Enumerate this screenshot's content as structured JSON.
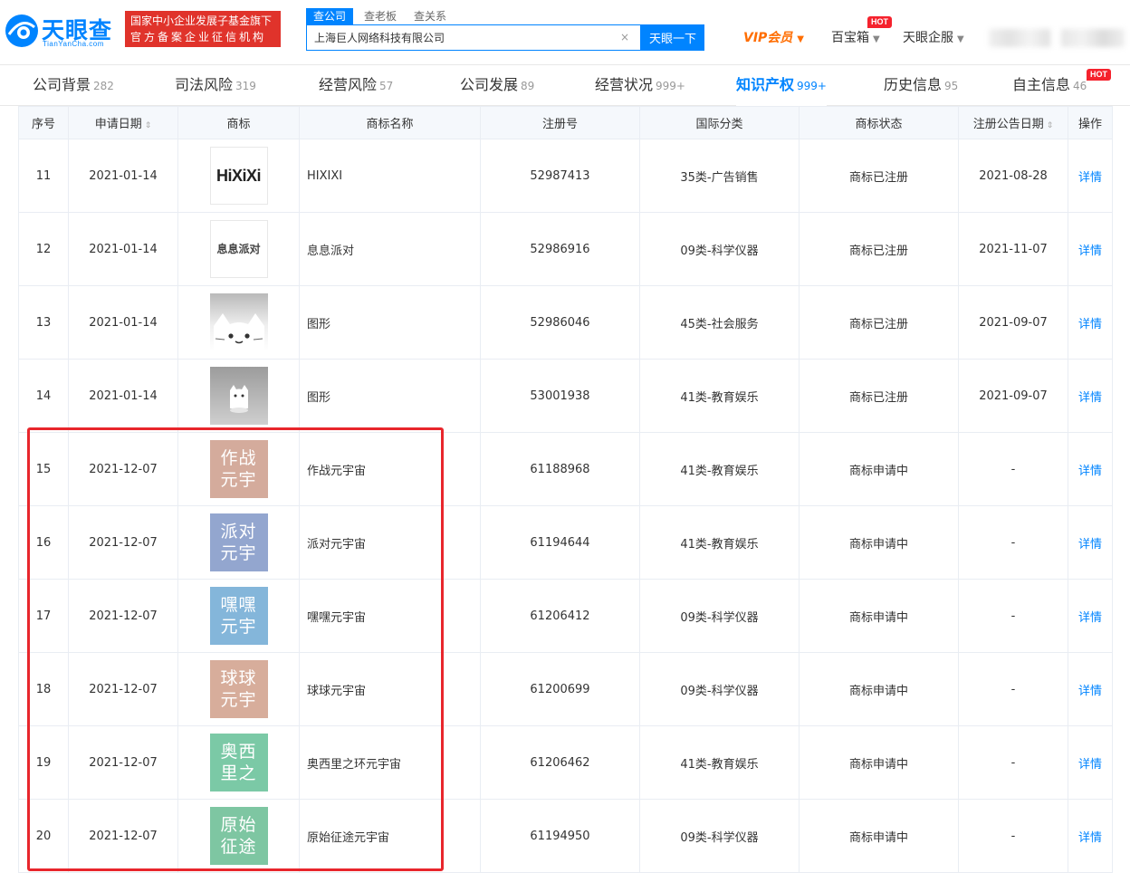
{
  "header": {
    "logo_text": "天眼查",
    "logo_sub": "TianYanCha.com",
    "slogan_line1": "国家中小企业发展子基金旗下",
    "slogan_line2": "官方备案企业征信机构",
    "search_tabs": [
      "查公司",
      "查老板",
      "查关系"
    ],
    "search_value": "上海巨人网络科技有限公司",
    "search_clear": "×",
    "search_button": "天眼一下",
    "vip_label": "VIP会员",
    "baobox_label": "百宝箱",
    "qifu_label": "天眼企服",
    "hot_label": "HOT",
    "caret": "▼"
  },
  "tabs": [
    {
      "label": "公司背景",
      "count": "282"
    },
    {
      "label": "司法风险",
      "count": "319"
    },
    {
      "label": "经营风险",
      "count": "57"
    },
    {
      "label": "公司发展",
      "count": "89"
    },
    {
      "label": "经营状况",
      "count": "999+"
    },
    {
      "label": "知识产权",
      "count": "999+",
      "active": true
    },
    {
      "label": "历史信息",
      "count": "95"
    },
    {
      "label": "自主信息",
      "count": "46"
    }
  ],
  "table": {
    "headers": [
      "序号",
      "申请日期",
      "商标",
      "商标名称",
      "注册号",
      "国际分类",
      "商标状态",
      "注册公告日期",
      "操作"
    ],
    "sort_glyph": "⇕",
    "rows": [
      {
        "no": "11",
        "date": "2021-01-14",
        "logo_text": "HiXiXi",
        "name": "HIXIXI",
        "reg": "52987413",
        "cls": "35类-广告销售",
        "status": "商标已注册",
        "pub": "2021-08-28",
        "op": "详情"
      },
      {
        "no": "12",
        "date": "2021-01-14",
        "logo_text": "息息派对",
        "name": "息息派对",
        "reg": "52986916",
        "cls": "09类-科学仪器",
        "status": "商标已注册",
        "pub": "2021-11-07",
        "op": "详情"
      },
      {
        "no": "13",
        "date": "2021-01-14",
        "logo_text": "",
        "name": "图形",
        "reg": "52986046",
        "cls": "45类-社会服务",
        "status": "商标已注册",
        "pub": "2021-09-07",
        "op": "详情"
      },
      {
        "no": "14",
        "date": "2021-01-14",
        "logo_text": "",
        "name": "图形",
        "reg": "53001938",
        "cls": "41类-教育娱乐",
        "status": "商标已注册",
        "pub": "2021-09-07",
        "op": "详情"
      },
      {
        "no": "15",
        "date": "2021-12-07",
        "logo_line1": "作战",
        "logo_line2": "元宇",
        "name": "作战元宇宙",
        "reg": "61188968",
        "cls": "41类-教育娱乐",
        "status": "商标申请中",
        "pub": "-",
        "op": "详情"
      },
      {
        "no": "16",
        "date": "2021-12-07",
        "logo_line1": "派对",
        "logo_line2": "元宇",
        "name": "派对元宇宙",
        "reg": "61194644",
        "cls": "41类-教育娱乐",
        "status": "商标申请中",
        "pub": "-",
        "op": "详情"
      },
      {
        "no": "17",
        "date": "2021-12-07",
        "logo_line1": "嘿嘿",
        "logo_line2": "元宇",
        "name": "嘿嘿元宇宙",
        "reg": "61206412",
        "cls": "09类-科学仪器",
        "status": "商标申请中",
        "pub": "-",
        "op": "详情"
      },
      {
        "no": "18",
        "date": "2021-12-07",
        "logo_line1": "球球",
        "logo_line2": "元宇",
        "name": "球球元宇宙",
        "reg": "61200699",
        "cls": "09类-科学仪器",
        "status": "商标申请中",
        "pub": "-",
        "op": "详情"
      },
      {
        "no": "19",
        "date": "2021-12-07",
        "logo_line1": "奥西",
        "logo_line2": "里之",
        "name": "奥西里之环元宇宙",
        "reg": "61206462",
        "cls": "41类-教育娱乐",
        "status": "商标申请中",
        "pub": "-",
        "op": "详情"
      },
      {
        "no": "20",
        "date": "2021-12-07",
        "logo_line1": "原始",
        "logo_line2": "征途",
        "name": "原始征途元宇宙",
        "reg": "61194950",
        "cls": "09类-科学仪器",
        "status": "商标申请中",
        "pub": "-",
        "op": "详情"
      }
    ]
  },
  "colors": {
    "brand_blue": "#0084ff",
    "vip_orange": "#ff6d00",
    "highlight_red": "#e8262c",
    "tm_15": "#d4ab9c",
    "tm_16": "#93a6cf",
    "tm_17": "#84b6da",
    "tm_18": "#d7ad9b",
    "tm_19": "#7bc9a6",
    "tm_20": "#7ec6a2"
  }
}
